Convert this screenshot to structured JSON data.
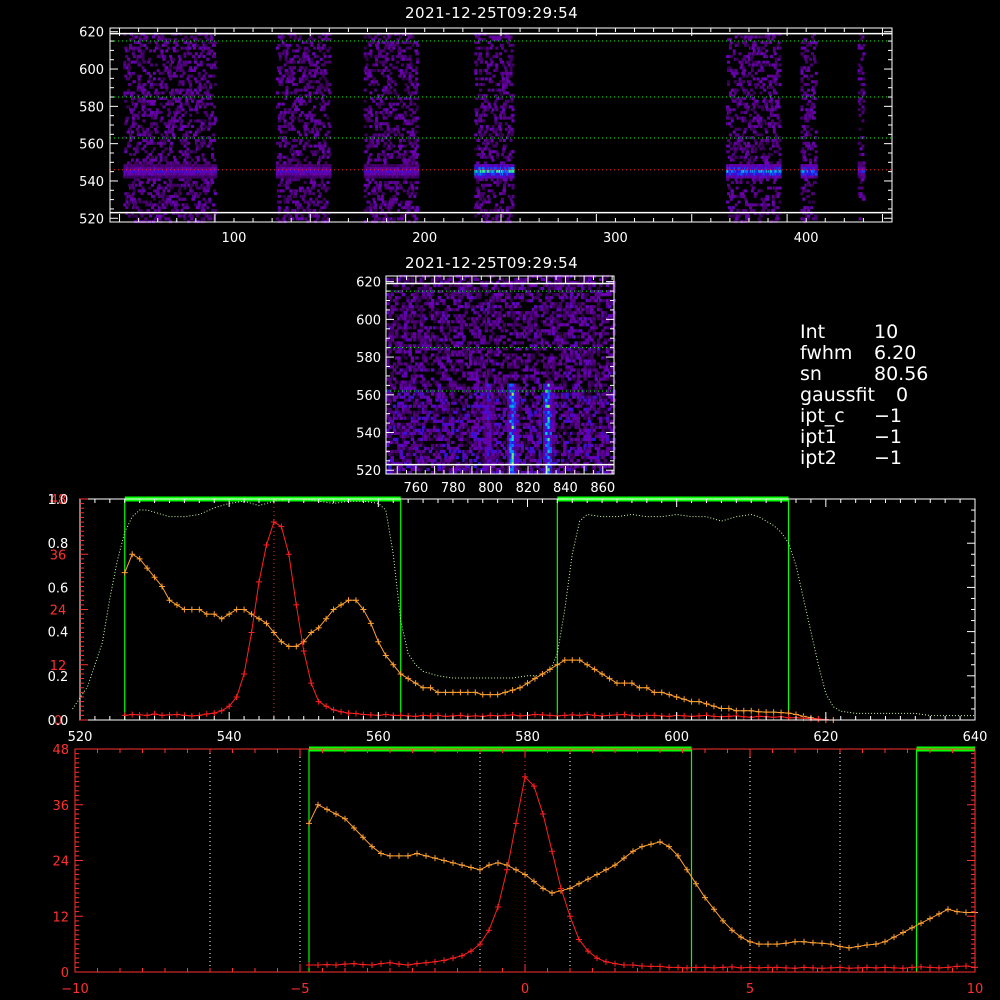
{
  "top_image": {
    "title": "2021-12-25T09:29:54",
    "x_ticks": [
      "100",
      "200",
      "300",
      "400"
    ],
    "y_ticks": [
      "520",
      "540",
      "560",
      "580",
      "600",
      "620"
    ],
    "xlim": [
      35,
      445
    ],
    "ylim": [
      518,
      622
    ],
    "solid_lines_y": [
      523,
      619
    ],
    "green_dotted_y": [
      563,
      585,
      615
    ],
    "red_dotted_y": [
      546
    ],
    "bands": [
      {
        "x0": 42,
        "x1": 90,
        "peak": 0.45
      },
      {
        "x0": 122,
        "x1": 150,
        "peak": 0.45
      },
      {
        "x0": 168,
        "x1": 196,
        "peak": 0.45
      },
      {
        "x0": 226,
        "x1": 246,
        "peak": 0.85
      },
      {
        "x0": 358,
        "x1": 386,
        "peak": 0.75
      },
      {
        "x0": 397,
        "x1": 405,
        "peak": 0.7
      },
      {
        "x0": 427,
        "x1": 430,
        "peak": 0.5
      }
    ]
  },
  "zoom_image": {
    "title": "2021-12-25T09:29:54",
    "x_ticks": [
      "760",
      "780",
      "800",
      "820",
      "840",
      "860"
    ],
    "y_ticks": [
      "520",
      "540",
      "560",
      "580",
      "600",
      "620"
    ],
    "xlim": [
      744,
      866
    ],
    "ylim": [
      518,
      623
    ],
    "solid_lines_y": [
      523,
      619
    ],
    "green_dotted_y": [
      562,
      585,
      615
    ],
    "hot_columns": [
      {
        "x": 811,
        "peak": 0.9
      },
      {
        "x": 830,
        "peak": 1.0
      },
      {
        "x": 798,
        "peak": 0.5
      }
    ]
  },
  "info": [
    {
      "key": "Int",
      "val": "10"
    },
    {
      "key": "fwhm",
      "val": "6.20"
    },
    {
      "key": "sn",
      "val": "80.56"
    },
    {
      "key": "gaussfit",
      "val": "0"
    },
    {
      "key": "ipt_c",
      "val": "−1"
    },
    {
      "key": "ipt1",
      "val": "−1"
    },
    {
      "key": "ipt2",
      "val": "−1"
    }
  ],
  "colors": {
    "orange": "#ffa030",
    "red": "#ff2020",
    "green": "#00ff00",
    "pale_green": "#c8ffa0",
    "axis_red": "#ff3030"
  },
  "chart_data": [
    {
      "type": "line",
      "title": "",
      "xlabel": "",
      "ylabel": "",
      "xlim": [
        520,
        640
      ],
      "ylim": [
        0,
        48
      ],
      "ylim_right": [
        0,
        1
      ],
      "x_ticks": [
        "520",
        "540",
        "560",
        "580",
        "600",
        "620",
        "640"
      ],
      "y_ticks_left": [
        "0",
        "12",
        "24",
        "36",
        "48"
      ],
      "y_ticks_right": [
        "0.0",
        "0.2",
        "0.4",
        "0.6",
        "0.8",
        "1.0"
      ],
      "red_dotted_x": [
        546
      ],
      "green_windows": [
        [
          526,
          563
        ],
        [
          584,
          615
        ]
      ],
      "series": [
        {
          "color": "orange",
          "x": [
            526,
            527,
            528,
            529,
            530,
            531,
            532,
            533,
            534,
            535,
            536,
            537,
            538,
            539,
            540,
            541,
            542,
            543,
            544,
            545,
            546,
            547,
            548,
            549,
            550,
            551,
            552,
            553,
            554,
            555,
            556,
            557,
            558,
            559,
            560,
            561,
            562,
            563,
            564,
            565,
            566,
            567,
            568,
            569,
            570,
            571,
            572,
            573,
            574,
            575,
            576,
            577,
            578,
            579,
            580,
            581,
            582,
            583,
            584,
            585,
            586,
            587,
            588,
            589,
            590,
            591,
            592,
            593,
            594,
            595,
            596,
            597,
            598,
            599,
            600,
            601,
            602,
            603,
            604,
            605,
            606,
            607,
            608,
            609,
            610,
            611,
            612,
            613,
            614,
            615,
            616,
            617,
            618,
            619,
            620,
            621
          ],
          "y": [
            32,
            36,
            35,
            33,
            31,
            29,
            26,
            25,
            24,
            24,
            24,
            23,
            23,
            22,
            23,
            24,
            24,
            23,
            22,
            21,
            19,
            17,
            16,
            16,
            17,
            19,
            20,
            22,
            24,
            25,
            26,
            26,
            24,
            21,
            17,
            14,
            12,
            10,
            9,
            8,
            7,
            7,
            6,
            6,
            6,
            6,
            6,
            6,
            5.5,
            5.5,
            5.5,
            6,
            6.5,
            7,
            8,
            9,
            10,
            11,
            12,
            13,
            13,
            13,
            12,
            11,
            10,
            9,
            8,
            8,
            8,
            7,
            7,
            6,
            6,
            5.5,
            5,
            4.5,
            4,
            4,
            3.5,
            3,
            2.5,
            2.5,
            2,
            2,
            2,
            1.8,
            1.7,
            1.7,
            1.6,
            1.5,
            1.2,
            0.8,
            0.5,
            0.2,
            0,
            0
          ]
        },
        {
          "color": "red",
          "x": [
            526,
            527,
            528,
            529,
            530,
            531,
            532,
            533,
            534,
            535,
            536,
            537,
            538,
            539,
            540,
            541,
            542,
            543,
            544,
            545,
            546,
            547,
            548,
            549,
            550,
            551,
            552,
            553,
            554,
            555,
            556,
            557,
            558,
            559,
            560,
            561,
            562,
            563,
            564,
            565,
            566,
            567,
            568,
            569,
            570,
            571,
            572,
            573,
            574,
            575,
            576,
            577,
            578,
            579,
            580,
            581,
            582,
            583,
            584,
            585,
            586,
            587,
            588,
            589,
            590,
            591,
            592,
            593,
            594,
            595,
            596,
            597,
            598,
            599,
            600,
            601,
            602,
            603,
            604,
            605,
            606,
            607,
            608,
            609,
            610,
            611,
            612,
            613,
            614,
            615,
            616,
            617,
            618,
            619,
            620
          ],
          "y": [
            1,
            1.2,
            1.1,
            1,
            1.3,
            1,
            1.1,
            1.2,
            1,
            0.9,
            1,
            1.3,
            1.5,
            2,
            3,
            5,
            10,
            19,
            30,
            38,
            43,
            42,
            36,
            25,
            15,
            8,
            4,
            3,
            2.2,
            1.8,
            1.5,
            1.4,
            1.2,
            1.1,
            1,
            1.2,
            1,
            1,
            0.9,
            0.8,
            1,
            0.9,
            1,
            0.8,
            0.9,
            1,
            0.8,
            0.9,
            0.8,
            1,
            0.9,
            1,
            1.1,
            0.9,
            1,
            1.2,
            1.1,
            1,
            0.9,
            1,
            1.1,
            1,
            1.2,
            1,
            0.9,
            1,
            1.1,
            1.2,
            1,
            0.9,
            1,
            1,
            0.9,
            0.8,
            1,
            0.9,
            0.8,
            0.9,
            1,
            0.8,
            0.7,
            0.8,
            0.9,
            0.7,
            0.6,
            0.8,
            0.7,
            0.6,
            0.7,
            0.5,
            0.5,
            0.4,
            0.3,
            0.2,
            0.1
          ]
        },
        {
          "color": "pale_green",
          "axis": "right",
          "x": [
            519,
            521,
            523,
            524,
            525,
            526,
            527,
            528,
            529,
            530,
            532,
            534,
            536,
            538,
            540,
            542,
            544,
            546,
            548,
            550,
            552,
            554,
            556,
            558,
            560,
            561,
            562,
            563,
            564,
            565,
            566,
            568,
            570,
            572,
            574,
            576,
            578,
            580,
            582,
            583,
            584,
            585,
            586,
            587,
            588,
            590,
            592,
            594,
            596,
            598,
            600,
            602,
            604,
            606,
            608,
            610,
            611,
            612,
            613,
            614,
            615,
            616,
            617,
            618,
            619,
            620,
            621,
            622,
            624,
            626,
            628,
            630,
            632,
            634,
            636,
            638,
            640
          ],
          "y": [
            0.05,
            0.15,
            0.35,
            0.55,
            0.72,
            0.85,
            0.92,
            0.95,
            0.95,
            0.94,
            0.92,
            0.92,
            0.93,
            0.96,
            0.98,
            0.99,
            0.97,
            0.99,
            1.0,
            1.0,
            0.99,
            0.98,
            0.99,
            0.99,
            0.98,
            0.95,
            0.75,
            0.45,
            0.3,
            0.25,
            0.22,
            0.2,
            0.19,
            0.19,
            0.19,
            0.19,
            0.19,
            0.2,
            0.2,
            0.22,
            0.3,
            0.5,
            0.75,
            0.9,
            0.93,
            0.92,
            0.92,
            0.93,
            0.92,
            0.92,
            0.93,
            0.92,
            0.92,
            0.9,
            0.92,
            0.93,
            0.92,
            0.9,
            0.88,
            0.85,
            0.8,
            0.7,
            0.55,
            0.4,
            0.25,
            0.12,
            0.06,
            0.04,
            0.03,
            0.03,
            0.03,
            0.03,
            0.03,
            0.02,
            0.02,
            0.02,
            0.02
          ]
        }
      ]
    },
    {
      "type": "line",
      "title": "",
      "xlabel": "",
      "ylabel": "",
      "xlim": [
        -10,
        10
      ],
      "ylim": [
        0,
        48
      ],
      "x_ticks": [
        "−10",
        "−5",
        "0",
        "5",
        "10"
      ],
      "y_ticks": [
        "0",
        "12",
        "24",
        "36",
        "48"
      ],
      "white_dotted_x": [
        -7,
        -5,
        -1,
        1,
        5,
        7
      ],
      "red_dotted_x": [
        0
      ],
      "green_windows": [
        [
          -4.8,
          3.7
        ],
        [
          8.7,
          10
        ]
      ],
      "series": [
        {
          "color": "orange",
          "x": [
            -4.8,
            -4.6,
            -4.4,
            -4.2,
            -4.0,
            -3.8,
            -3.6,
            -3.4,
            -3.2,
            -3.0,
            -2.8,
            -2.6,
            -2.4,
            -2.2,
            -2.0,
            -1.8,
            -1.6,
            -1.4,
            -1.2,
            -1.0,
            -0.8,
            -0.6,
            -0.4,
            -0.2,
            0,
            0.2,
            0.4,
            0.6,
            0.8,
            1.0,
            1.2,
            1.4,
            1.6,
            1.8,
            2.0,
            2.2,
            2.4,
            2.6,
            2.8,
            3.0,
            3.2,
            3.4,
            3.6,
            3.8,
            4.0,
            4.2,
            4.4,
            4.6,
            4.8,
            5.0,
            5.2,
            5.4,
            5.6,
            5.8,
            6.0,
            6.2,
            6.4,
            6.6,
            6.8,
            7.0,
            7.2,
            7.4,
            7.6,
            7.8,
            8.0,
            8.2,
            8.4,
            8.6,
            8.8,
            9.0,
            9.2,
            9.4,
            9.6,
            9.8,
            10.0
          ],
          "y": [
            32,
            36,
            35,
            34,
            33,
            31,
            29,
            27,
            25.5,
            25,
            25,
            25,
            25.5,
            25,
            24.5,
            24,
            23.5,
            23,
            22.5,
            22,
            23,
            23.5,
            23,
            22,
            21,
            19.5,
            18,
            17,
            17.5,
            18,
            19,
            20,
            21,
            22,
            23,
            24.5,
            26,
            27,
            27.5,
            28,
            27,
            25,
            22,
            19,
            16,
            13.5,
            11,
            9,
            7.5,
            6.5,
            6,
            6,
            6,
            6.2,
            6.5,
            6.5,
            6.3,
            6.2,
            6,
            5.5,
            5.2,
            5.5,
            5.8,
            6,
            6.5,
            7.5,
            8.5,
            9.5,
            10.5,
            11.5,
            12.5,
            13.5,
            13,
            12.8,
            12.8
          ]
        },
        {
          "color": "red",
          "x": [
            -4.8,
            -4.6,
            -4.4,
            -4.2,
            -4.0,
            -3.8,
            -3.6,
            -3.4,
            -3.2,
            -3.0,
            -2.8,
            -2.6,
            -2.4,
            -2.2,
            -2.0,
            -1.8,
            -1.6,
            -1.4,
            -1.2,
            -1.0,
            -0.8,
            -0.6,
            -0.4,
            -0.2,
            0,
            0.2,
            0.4,
            0.6,
            0.8,
            1.0,
            1.2,
            1.4,
            1.6,
            1.8,
            2.0,
            2.2,
            2.4,
            2.6,
            2.8,
            3.0,
            3.2,
            3.4,
            3.6,
            3.8,
            4.0,
            4.2,
            4.4,
            4.6,
            4.8,
            5.0,
            5.2,
            5.4,
            5.6,
            5.8,
            6.0,
            6.2,
            6.4,
            6.6,
            6.8,
            7.0,
            7.2,
            7.4,
            7.6,
            7.8,
            8.0,
            8.2,
            8.4,
            8.6,
            8.8,
            9.0,
            9.2,
            9.4,
            9.6,
            9.8,
            10.0
          ],
          "y": [
            1.5,
            1.5,
            1.6,
            1.5,
            1.7,
            1.8,
            1.6,
            1.5,
            1.8,
            2,
            1.7,
            1.5,
            1.8,
            2,
            2.2,
            2.5,
            3,
            3.5,
            4.5,
            6,
            9,
            14,
            22,
            32,
            42,
            40,
            34,
            26,
            18,
            12,
            7,
            4.5,
            3,
            2.2,
            1.8,
            1.5,
            1.5,
            1.3,
            1.2,
            1.2,
            1,
            1,
            0.9,
            1,
            1,
            0.9,
            1,
            1.1,
            0.9,
            1,
            0.9,
            1,
            1,
            0.9,
            0.8,
            1,
            0.9,
            0.8,
            0.9,
            1,
            0.8,
            0.9,
            1,
            0.9,
            1,
            0.9,
            0.8,
            1,
            1.1,
            1,
            0.9,
            1,
            1.2,
            1.3,
            1
          ]
        }
      ]
    }
  ]
}
